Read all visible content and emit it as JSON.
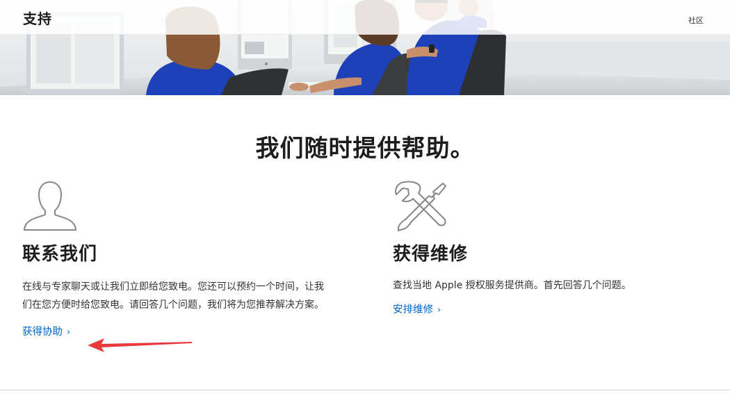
{
  "nav": {
    "brand": "支持",
    "community_link": "社区"
  },
  "hero": {
    "icon": "support-staff-photo"
  },
  "headline": "我们随时提供帮助。",
  "contact": {
    "icon": "person-silhouette-icon",
    "title": "联系我们",
    "description": "在线与专家聊天或让我们立即给您致电。您还可以预约一个时间，让我们在您方便时给您致电。请回答几个问题，我们将为您推荐解决方案。",
    "link_label": "获得协助",
    "link_chevron": "›"
  },
  "repair": {
    "icon": "wrench-screwdriver-icon",
    "title": "获得维修",
    "description": "查找当地 Apple 授权服务提供商。首先回答几个问题。",
    "link_label": "安排维修",
    "link_chevron": "›"
  },
  "colors": {
    "link": "#0066cc",
    "annotation_arrow": "#e8393c",
    "text": "#1d1d1f",
    "staff_shirt": "#1e40b8"
  }
}
